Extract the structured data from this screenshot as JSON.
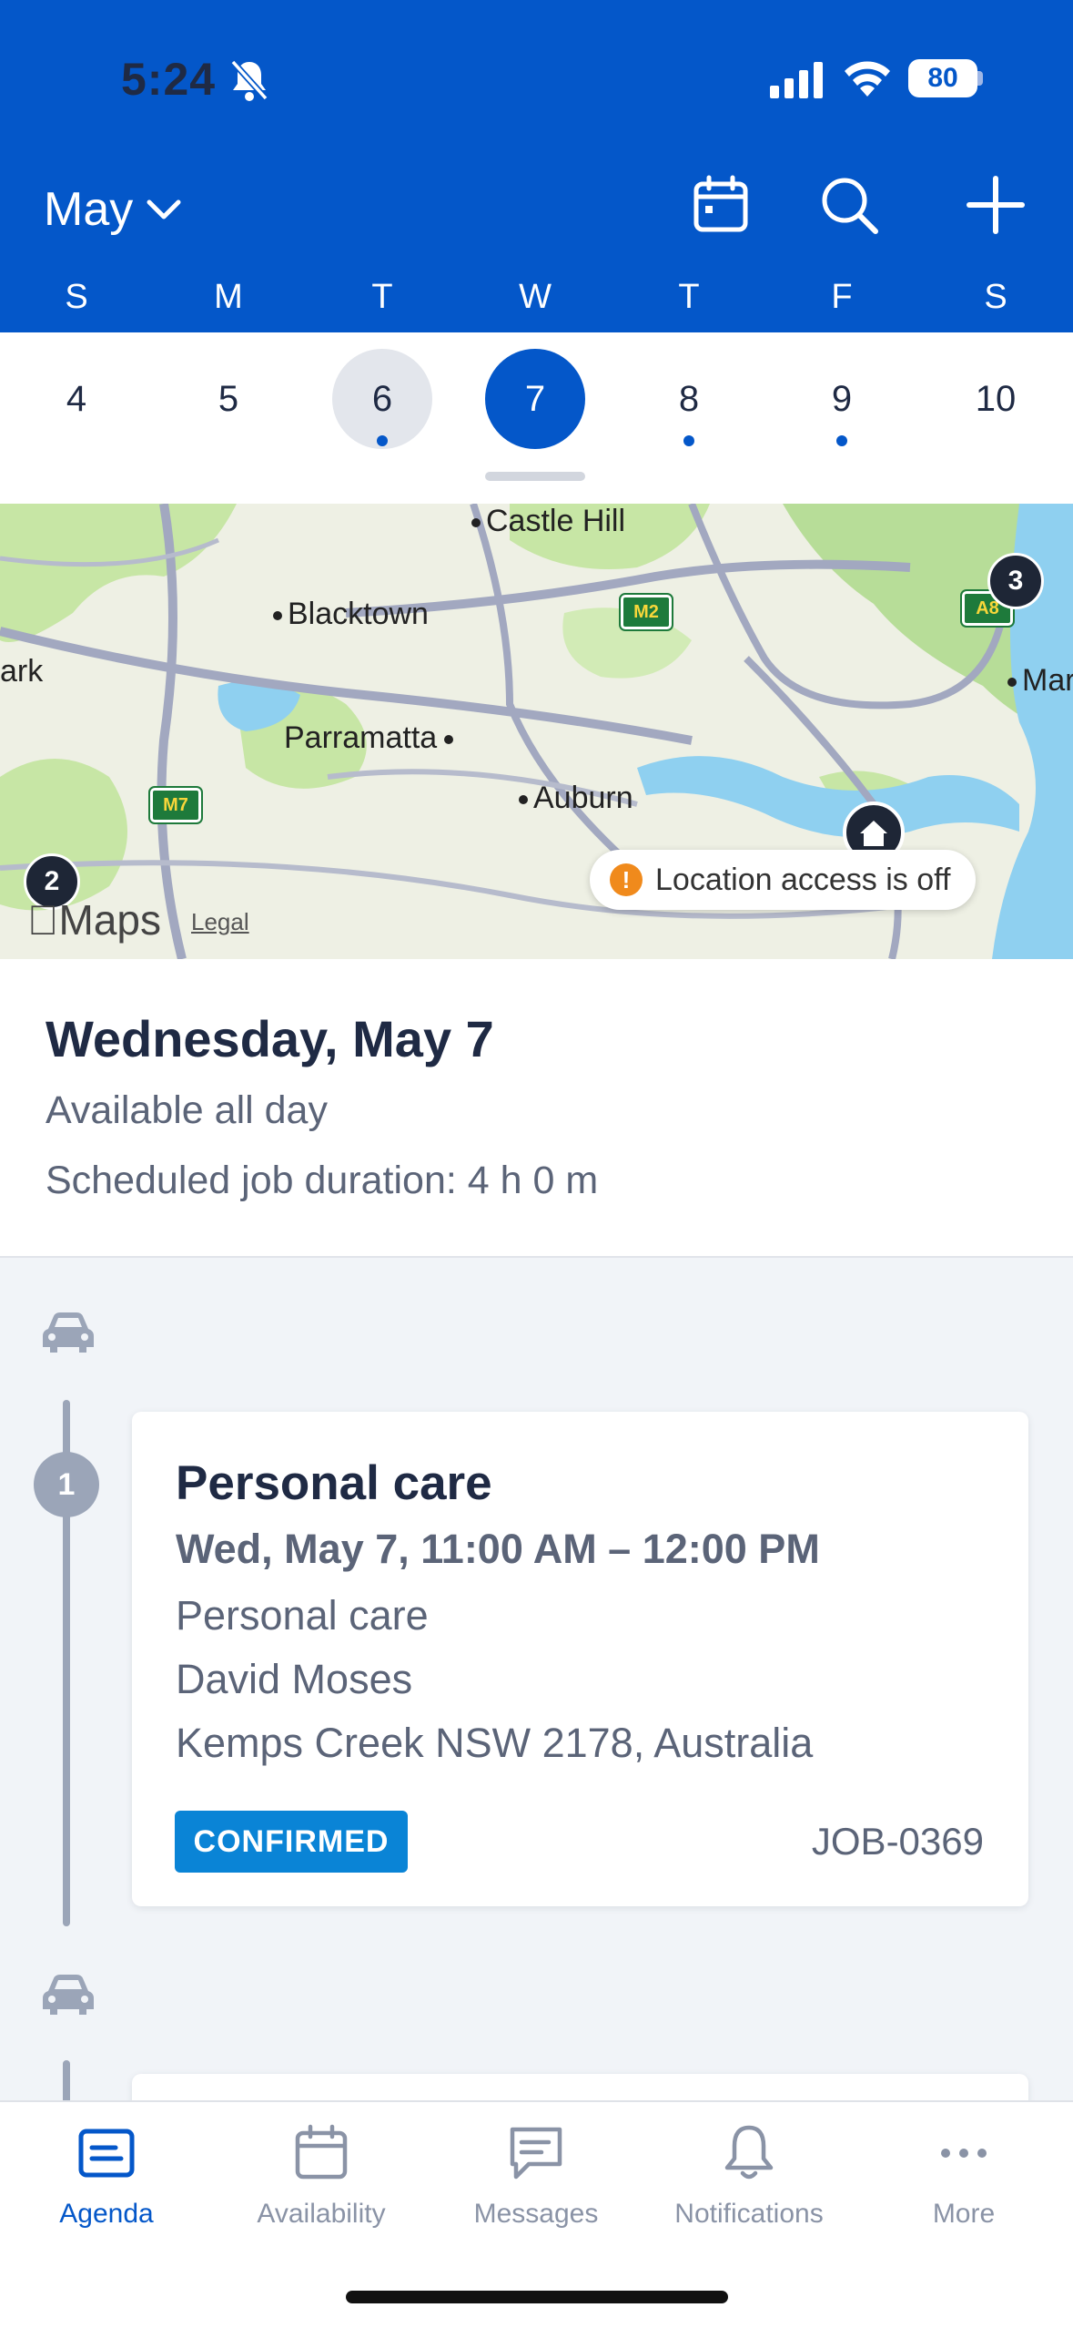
{
  "status_bar": {
    "time": "5:24",
    "battery": "80"
  },
  "header": {
    "month": "May",
    "weekdays": [
      "S",
      "M",
      "T",
      "W",
      "T",
      "F",
      "S"
    ],
    "days": [
      "4",
      "5",
      "6",
      "7",
      "8",
      "9",
      "10"
    ],
    "today_index": 2,
    "selected_index": 3,
    "days_with_jobs": [
      2,
      4,
      5
    ]
  },
  "map": {
    "cities": [
      "Castle Hill",
      "Blacktown",
      "Parramatta",
      "Auburn",
      "ark",
      "Mar"
    ],
    "roads": [
      "M2",
      "M7",
      "A8"
    ],
    "clusters": [
      "3",
      "2"
    ],
    "maps_label": "Maps",
    "legal": "Legal",
    "location_notice": "Location access is off"
  },
  "summary": {
    "date_title": "Wednesday, May 7",
    "availability": "Available all day",
    "duration": "Scheduled job duration: 4 h 0 m"
  },
  "jobs": [
    {
      "index": "1",
      "title": "Personal care",
      "time": "Wed, May 7, 11:00 AM – 12:00 PM",
      "service": "Personal care",
      "client": "David Moses",
      "address": "Kemps Creek NSW 2178, Australia",
      "status": "CONFIRMED",
      "job_id": "JOB-0369"
    }
  ],
  "tabs": [
    {
      "label": "Agenda",
      "icon": "agenda-icon",
      "active": true
    },
    {
      "label": "Availability",
      "icon": "calendar-icon",
      "active": false
    },
    {
      "label": "Messages",
      "icon": "message-icon",
      "active": false
    },
    {
      "label": "Notifications",
      "icon": "bell-icon",
      "active": false
    },
    {
      "label": "More",
      "icon": "more-icon",
      "active": false
    }
  ],
  "colors": {
    "brand": "#0457c9",
    "status_confirmed": "#0a84d6"
  }
}
